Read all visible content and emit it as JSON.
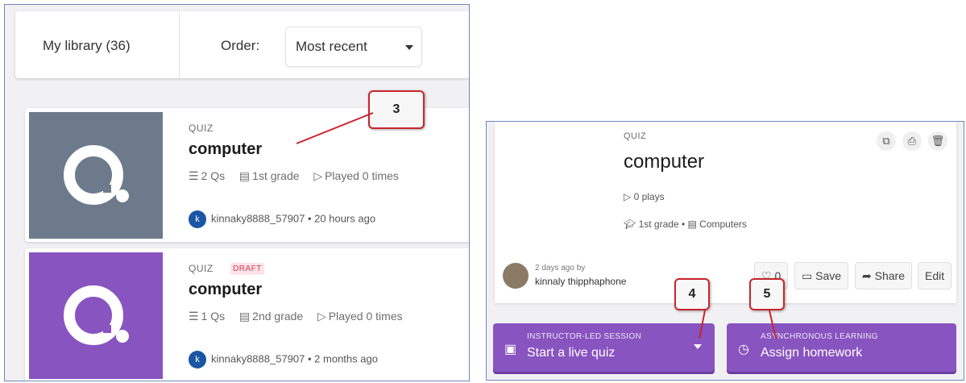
{
  "library": {
    "title": "My library (36)",
    "order_label": "Order:",
    "order_value": "Most recent"
  },
  "cards": [
    {
      "type": "QUIZ",
      "draft": "",
      "title": "computer",
      "questions": "2 Qs",
      "grade": "1st grade",
      "played": "Played 0 times",
      "author": "kinnaky8888_57907",
      "time": "20 hours ago",
      "thumb_color": "#6c7a8c"
    },
    {
      "type": "QUIZ",
      "draft": "DRAFT",
      "title": "computer",
      "questions": "1 Qs",
      "grade": "2nd grade",
      "played": "Played 0 times",
      "author": "kinnaky8888_57907",
      "time": "2 months ago",
      "thumb_color": "#8854c0"
    }
  ],
  "detail": {
    "type": "QUIZ",
    "title": "computer",
    "plays": "0 plays",
    "grade": "1st grade",
    "subject": "Computers",
    "time": "2 days ago by",
    "author": "kinnaly thipphaphone",
    "likes": "0",
    "save_label": "Save",
    "share_label": "Share",
    "edit_label": "Edit",
    "live": {
      "small": "INSTRUCTOR-LED SESSION",
      "main": "Start a live quiz"
    },
    "homework": {
      "small": "ASYNCHRONOUS LEARNING",
      "main": "Assign homework"
    }
  },
  "callouts": [
    "3",
    "4",
    "5"
  ],
  "colors": {
    "accent": "#8854c0",
    "callout_border": "#c9252c"
  }
}
